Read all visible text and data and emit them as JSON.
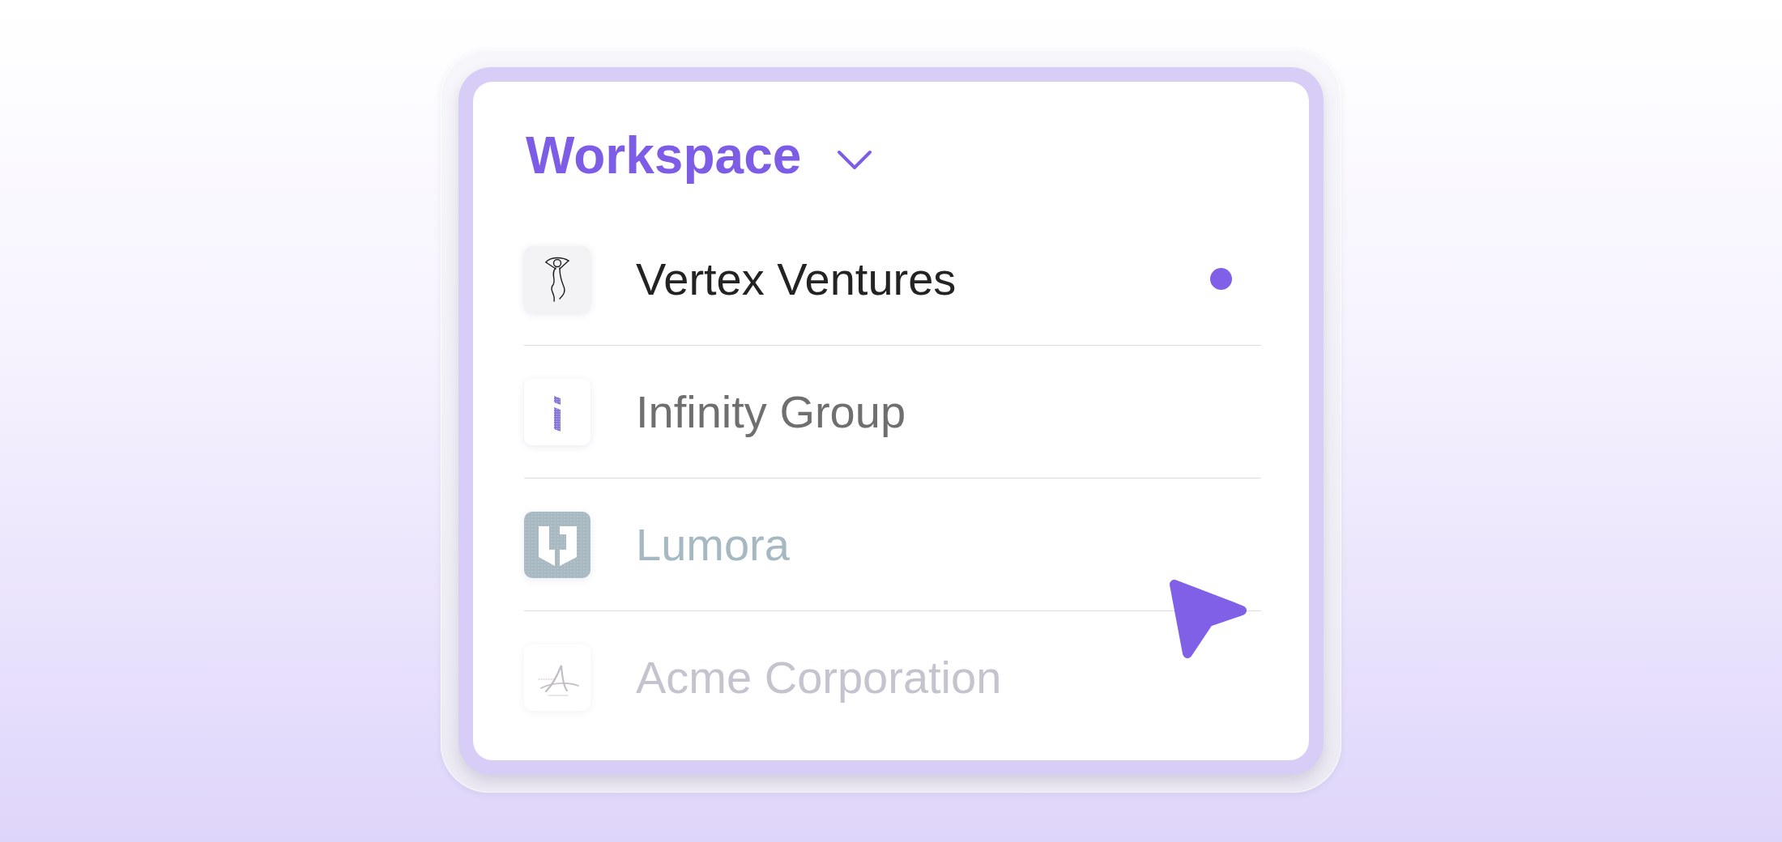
{
  "header": {
    "title": "Workspace"
  },
  "workspaces": [
    {
      "name": "Vertex Ventures",
      "kind": "figure",
      "selected": true
    },
    {
      "name": "Infinity Group",
      "kind": "stripe",
      "selected": false
    },
    {
      "name": "Lumora",
      "kind": "shield",
      "selected": false
    },
    {
      "name": "Acme Corporation",
      "kind": "script",
      "selected": false
    }
  ]
}
